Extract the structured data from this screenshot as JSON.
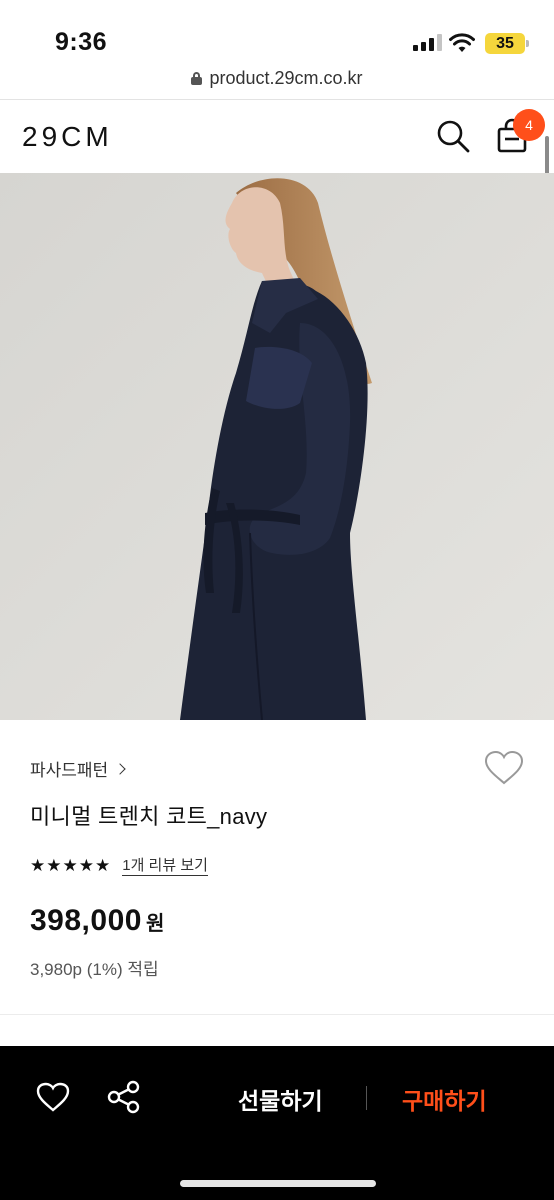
{
  "status_bar": {
    "time": "9:36",
    "battery": "35"
  },
  "url_bar": {
    "url": "product.29cm.co.kr"
  },
  "header": {
    "logo": "29CM",
    "cart_count": "4"
  },
  "product": {
    "brand": "파사드패턴",
    "name": "미니멀 트렌치 코트_navy",
    "rating_stars": 5,
    "review_link": "1개 리뷰 보기",
    "price": "398,000",
    "price_unit": "원",
    "points": "3,980p (1%) 적립"
  },
  "bottom_bar": {
    "gift_label": "선물하기",
    "buy_label": "구매하기"
  },
  "colors": {
    "accent": "#ff4f1a",
    "battery": "#f5d63c",
    "coat": "#1d2336",
    "background_photo": "#dcdbd7"
  },
  "icons": [
    "lock-icon",
    "search-icon",
    "shopping-bag-icon",
    "heart-icon",
    "share-icon",
    "chevron-right-icon",
    "star-icon",
    "wifi-icon",
    "signal-icon"
  ]
}
